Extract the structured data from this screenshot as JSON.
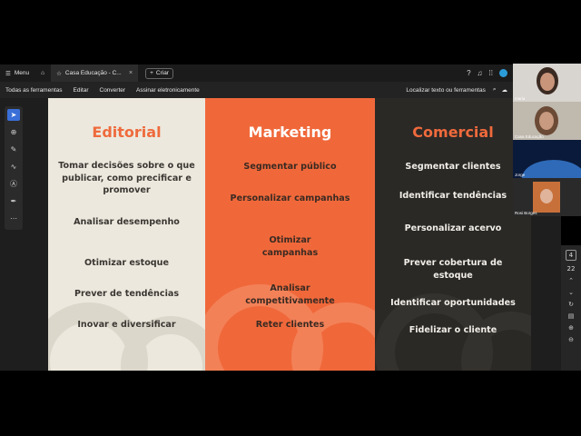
{
  "tabbar": {
    "menu_label": "Menu",
    "tab_title": "Casa Educação - C...",
    "new_tab_label": "Criar"
  },
  "toolbar": {
    "all_tools": "Todas as ferramentas",
    "edit": "Editar",
    "convert": "Converter",
    "sign": "Assinar eletronicamente",
    "search_label": "Localizar texto ou ferramentas"
  },
  "slide": {
    "columns": [
      {
        "title": "Editorial",
        "items": [
          "Tomar decisões sobre o que publicar, como precificar e promover",
          "Analisar desempenho",
          "Otimizar estoque",
          "Prever de tendências",
          "Inovar e diversificar"
        ]
      },
      {
        "title": "Marketing",
        "items": [
          "Segmentar público",
          "Personalizar  campanhas",
          "Otimizar campanhas",
          "Analisar competitivamente",
          "Reter clientes"
        ]
      },
      {
        "title": "Comercial",
        "items": [
          "Segmentar clientes",
          "Identificar tendências",
          "Personalizar acervo",
          "Prever cobertura de estoque",
          "Identificar oportunidades",
          "Fidelizar o cliente"
        ]
      }
    ],
    "colors": {
      "editorial_bg": "#ece8dd",
      "marketing_bg": "#f0683a",
      "comercial_bg": "#2b2926",
      "accent": "#ef6a3c"
    }
  },
  "pagenav": {
    "current_page": "4",
    "total_pages": "22"
  },
  "participants": [
    {
      "name": "maria"
    },
    {
      "name": "Casa Educação"
    },
    {
      "name": "Jorge"
    },
    {
      "name": "Rosi Borges"
    }
  ]
}
